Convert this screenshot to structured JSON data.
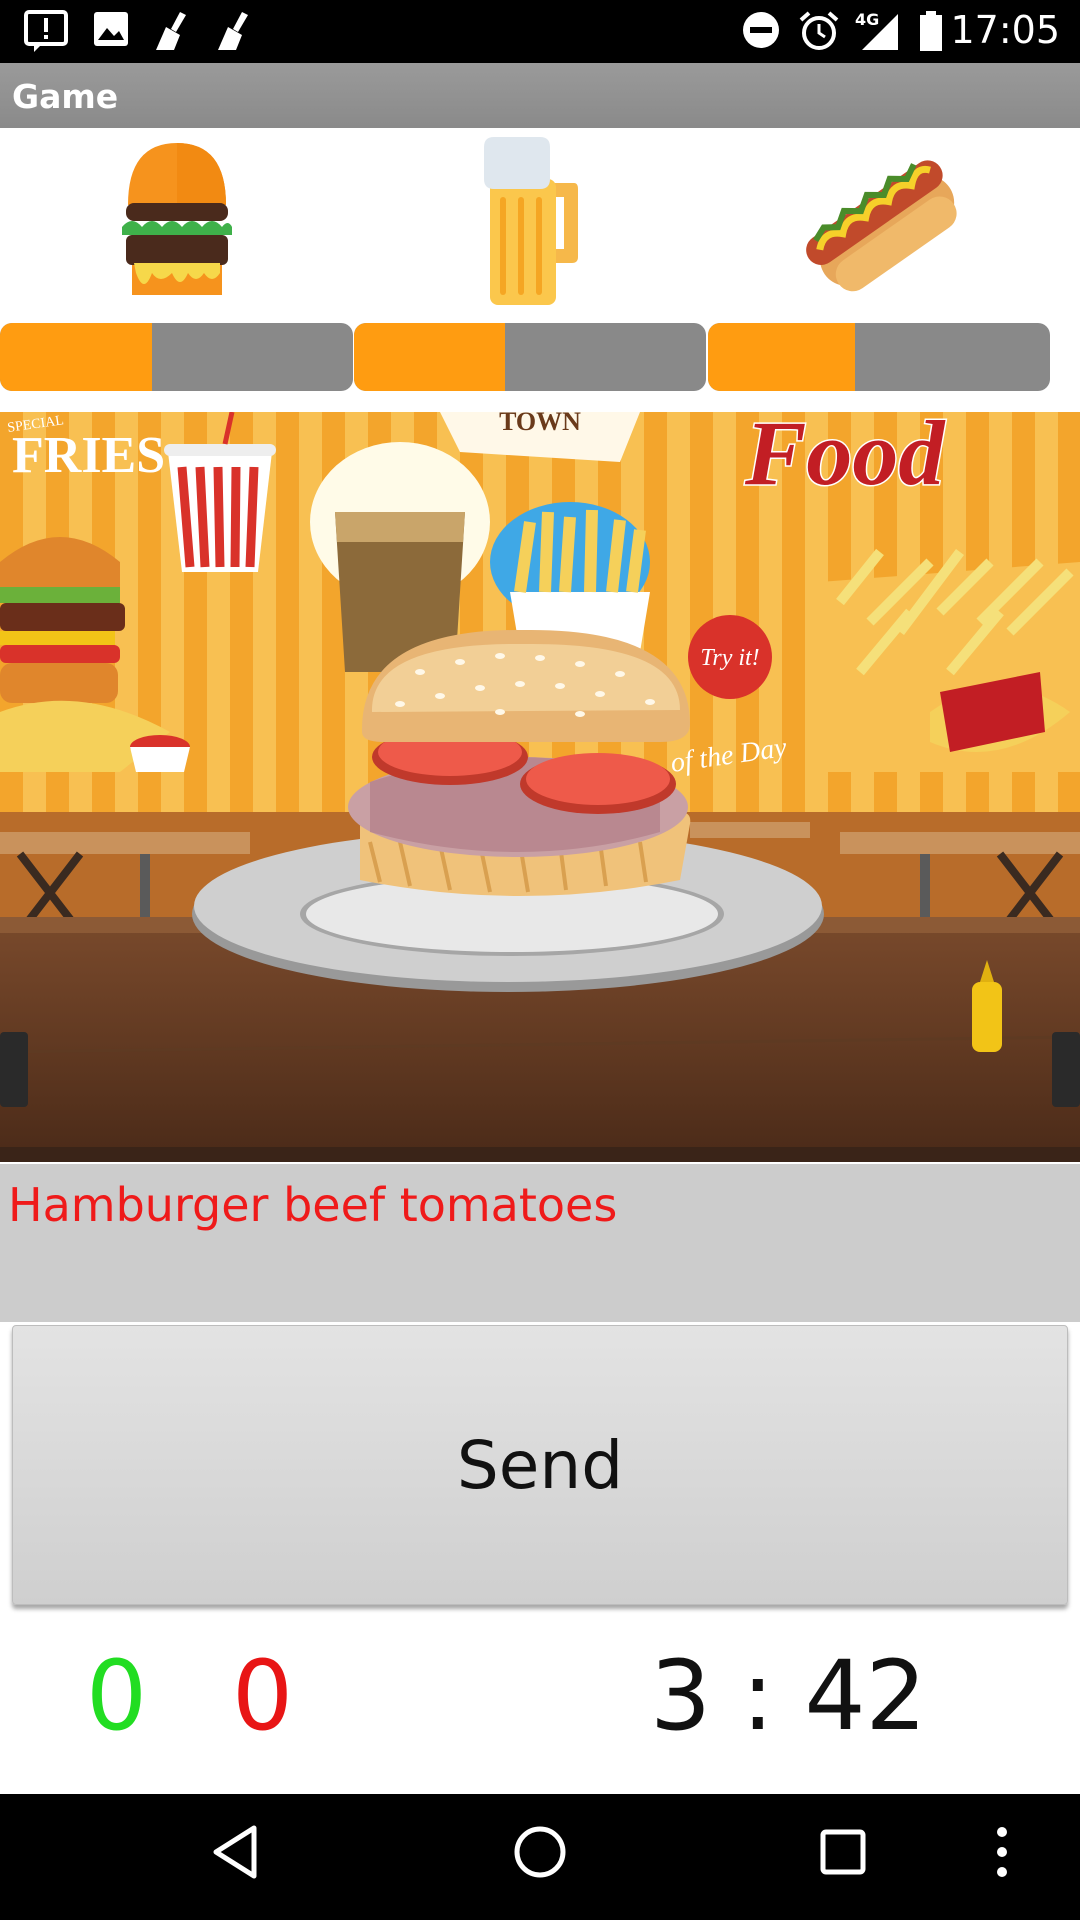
{
  "status_bar": {
    "time": "17:05",
    "network": "4G",
    "icons": [
      "alert-icon",
      "image-icon",
      "broom-icon",
      "broom-icon",
      "dnd-icon",
      "alarm-icon",
      "signal-icon",
      "battery-icon"
    ]
  },
  "action_bar": {
    "title": "Game"
  },
  "items": [
    {
      "icon": "burger-icon",
      "progress": 0.43
    },
    {
      "icon": "beer-icon",
      "progress": 0.43
    },
    {
      "icon": "hotdog-icon",
      "progress": 0.43
    }
  ],
  "scene": {
    "sign_fries": "FRIES",
    "sign_food": "Food",
    "sign_try": "Try it!",
    "sign_day": "of the Day",
    "sign_special": "SPECIAL",
    "sign_town": "TOWN"
  },
  "order": {
    "text": "Hamburger beef tomatoes"
  },
  "send_button": {
    "label": "Send"
  },
  "score": {
    "correct": "0",
    "wrong": "0"
  },
  "timer": {
    "text": "3 : 42"
  },
  "colors": {
    "progress_fill": "#ff9c11",
    "progress_track": "#898989",
    "order_text": "#ef1a1a",
    "correct": "#22dd22",
    "wrong": "#e81515"
  },
  "nav_bar": {
    "buttons": [
      "back-icon",
      "home-icon",
      "recents-icon",
      "overflow-menu-icon"
    ]
  }
}
